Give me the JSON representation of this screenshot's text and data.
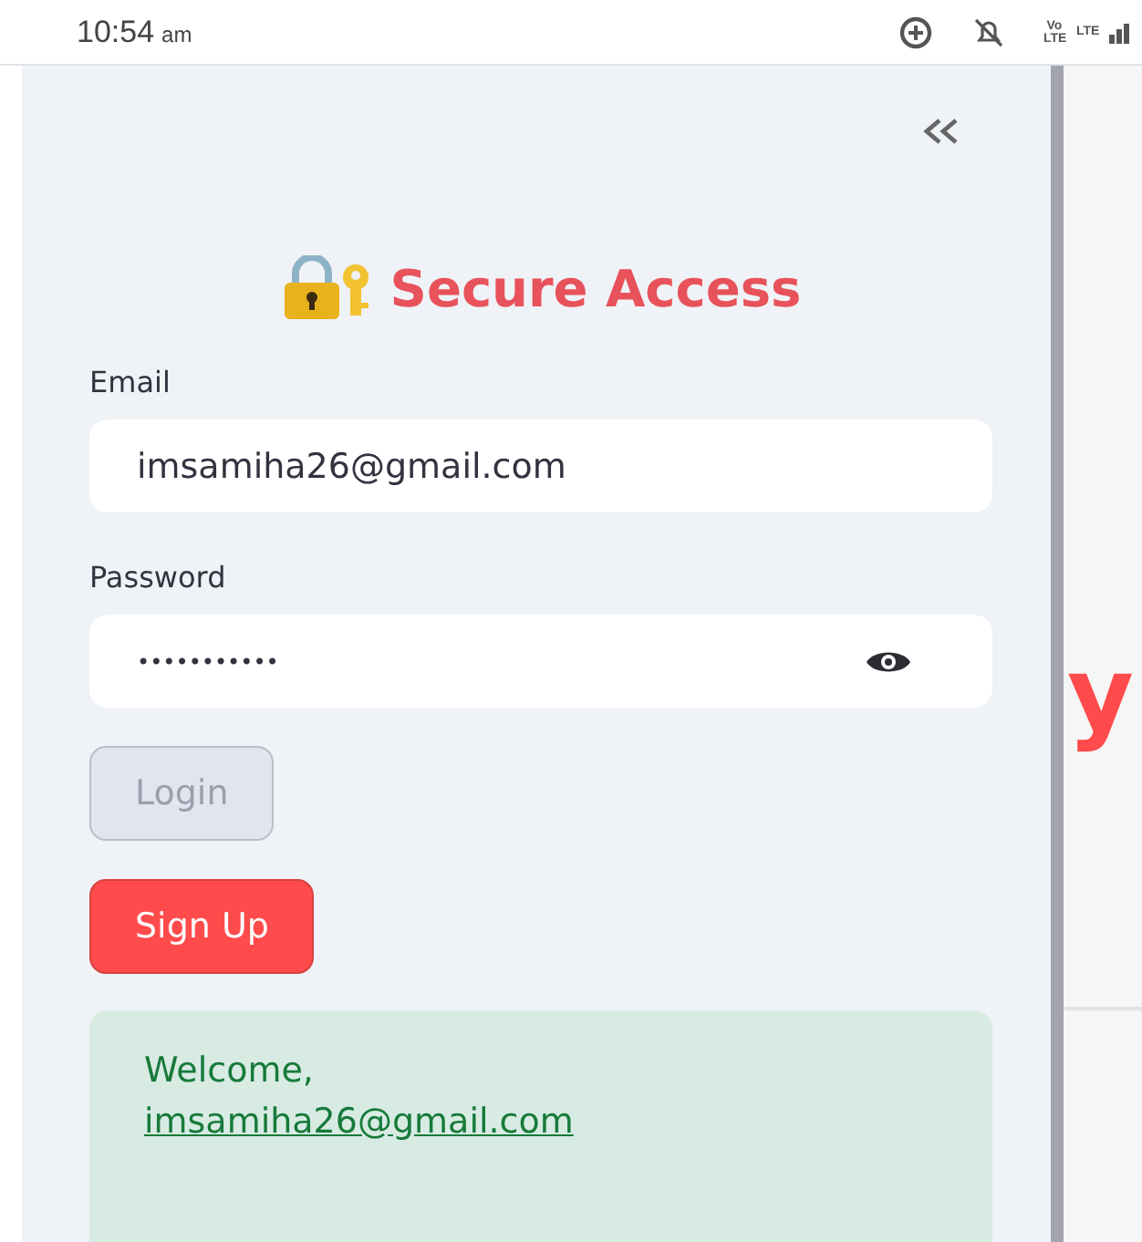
{
  "status_bar": {
    "time": "10:54",
    "meridiem": "am",
    "network_labels": [
      "Vo LTE",
      "LTE"
    ]
  },
  "sidebar": {
    "title": "Secure Access",
    "email": {
      "label": "Email",
      "value": "imsamiha26@gmail.com"
    },
    "password": {
      "label": "Password",
      "value": "•••••••••••"
    },
    "buttons": [
      {
        "kind": "secondary",
        "label": "Login",
        "disabled": true
      },
      {
        "kind": "primary",
        "label": "Sign Up",
        "disabled": false
      }
    ],
    "message": {
      "text": "Welcome,",
      "link": "imsamiha26@gmail.com"
    }
  },
  "main": {
    "heading_fragment": "y"
  }
}
